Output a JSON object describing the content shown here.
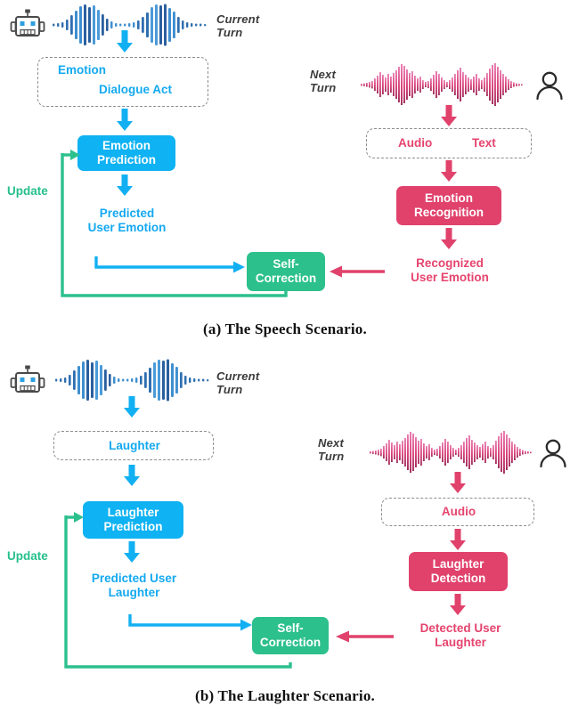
{
  "figure": {
    "panels": [
      {
        "id": "a",
        "caption": "(a) The Speech Scenario.",
        "left_flow": {
          "speaker_icon": "robot-icon",
          "turn_label_line1": "Current",
          "turn_label_line2": "Turn",
          "waveform": "blue-waveform",
          "dashed_items": [
            "Emotion",
            "Dialogue Act"
          ],
          "module": "Emotion\nPrediction",
          "module_line1": "Emotion",
          "module_line2": "Prediction",
          "output_line1": "Predicted",
          "output_line2": "User Emotion",
          "loop_label": "Update"
        },
        "right_flow": {
          "speaker_icon": "person-icon",
          "turn_label_line1": "Next",
          "turn_label_line2": "Turn",
          "waveform": "pink-waveform",
          "dashed_items": [
            "Audio",
            "Text"
          ],
          "module_line1": "Emotion",
          "module_line2": "Recognition",
          "output_line1": "Recognized",
          "output_line2": "User Emotion"
        },
        "merge_node_line1": "Self-",
        "merge_node_line2": "Correction"
      },
      {
        "id": "b",
        "caption": "(b) The Laughter Scenario.",
        "left_flow": {
          "speaker_icon": "robot-icon",
          "turn_label_line1": "Current",
          "turn_label_line2": "Turn",
          "waveform": "blue-waveform",
          "dashed_items": [
            "Laughter"
          ],
          "module_line1": "Laughter",
          "module_line2": "Prediction",
          "output_line1": "Predicted User",
          "output_line2": "Laughter",
          "loop_label": "Update"
        },
        "right_flow": {
          "speaker_icon": "person-icon",
          "turn_label_line1": "Next",
          "turn_label_line2": "Turn",
          "waveform": "pink-waveform",
          "dashed_items": [
            "Audio"
          ],
          "module_line1": "Laughter",
          "module_line2": "Detection",
          "output_line1": "Detected User",
          "output_line2": "Laughter"
        },
        "merge_node_line1": "Self-",
        "merge_node_line2": "Correction"
      }
    ],
    "colors": {
      "blue": "#0fb2f2",
      "blue_text": "#14a9f0",
      "pink": "#e0426c",
      "pink_text": "#e5446e",
      "green": "#2cc08d",
      "green_text": "#26bf8c",
      "dashed_border": "#8d8d8d",
      "icon_dark": "#2b2b2b"
    }
  }
}
